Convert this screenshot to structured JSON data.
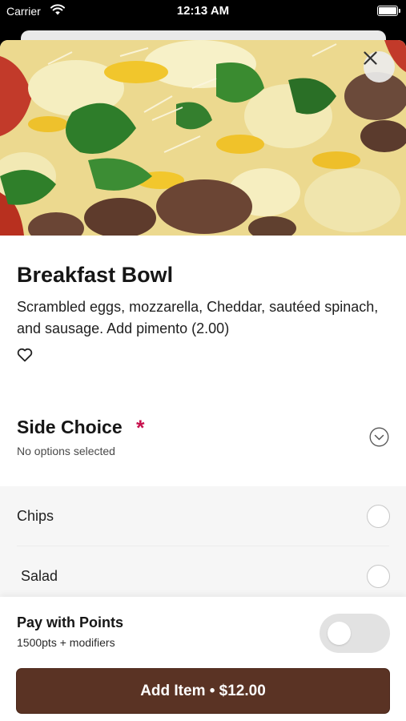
{
  "status_bar": {
    "carrier": "Carrier",
    "time": "12:13 AM"
  },
  "item": {
    "title": "Breakfast Bowl",
    "description": "Scrambled eggs, mozzarella, Cheddar, sautéed spinach, and sausage. Add pimento (2.00)",
    "favorite_icon": "heart-outline-icon"
  },
  "side_choice": {
    "title": "Side Choice",
    "required_marker": "*",
    "subtitle": "No options selected",
    "options": [
      {
        "label": "Chips",
        "selected": false
      },
      {
        "label": "Salad",
        "selected": false
      }
    ]
  },
  "points": {
    "title": "Pay with Points",
    "subtitle": "1500pts + modifiers",
    "enabled": false
  },
  "add_button": {
    "label": "Add Item • $12.00"
  },
  "colors": {
    "accent_button": "#5a3324",
    "required_star": "#c8124e",
    "toggle_off": "#e2e2e2"
  }
}
